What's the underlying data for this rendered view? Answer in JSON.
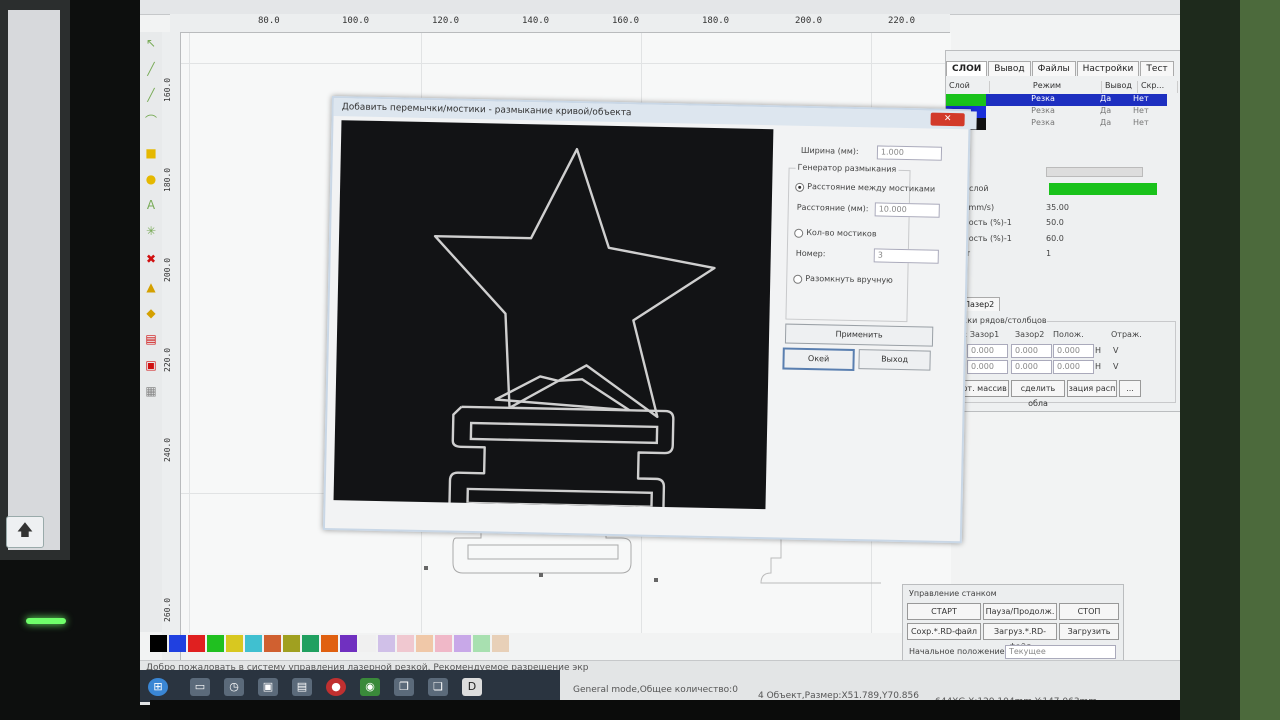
{
  "ruler_top": [
    "80.0",
    "100.0",
    "120.0",
    "140.0",
    "160.0",
    "180.0",
    "200.0",
    "220.0"
  ],
  "ruler_left": [
    "160.0",
    "180.0",
    "200.0",
    "220.0",
    "240.0",
    "260.0"
  ],
  "dialog": {
    "title": "Добавить перемычки/мостики - размыкание кривой/объекта",
    "close": "✕",
    "width_label": "Ширина (мм):",
    "width_value": "1.000",
    "group_title": "Генератор размыкания",
    "opt_distance": "Расстояние между мостиками",
    "distance_label": "Расстояние (мм):",
    "distance_value": "10.000",
    "opt_count": "Кол-во мостиков",
    "number_label": "Номер:",
    "number_value": "3",
    "opt_manual": "Разомкнуть вручную",
    "apply": "Применить",
    "ok": "Окей",
    "exit": "Выход"
  },
  "right_panel": {
    "tabs": [
      "СЛОИ",
      "Вывод",
      "Файлы",
      "Настройки",
      "Тест"
    ],
    "headers": [
      "Слой",
      "Режим",
      "Вывод",
      "Скр..."
    ],
    "rows": [
      {
        "color": "#19c21b",
        "mode": "Резка",
        "out": "Да",
        "hide": "Нет",
        "selected": true
      },
      {
        "color": "#1a2fd8",
        "mode": "Резка",
        "out": "Да",
        "hide": "Нет",
        "selected": false
      },
      {
        "color": "#111111",
        "mode": "Резка",
        "out": "Да",
        "hide": "Нет",
        "selected": false
      }
    ],
    "prop_layer": "ий слой",
    "prop_speed": "ть(mm/s)",
    "prop_speed_val": "35.00",
    "prop_p1": "щность (%)-1",
    "prop_p1_val": "50.0",
    "prop_p2": "щность (%)-1",
    "prop_p2_val": "60.0",
    "prop_prio": "тет",
    "prop_prio_val": "1",
    "laser2": "Лазер2",
    "array_title": "ржки рядов/столбцов",
    "array_gap1": "во: Зазор1",
    "array_gap2": "Зазор2",
    "array_pos": "Полож.",
    "array_mirror": "Отраж.",
    "array_val": "0.000",
    "array_h": "H",
    "array_v": "V",
    "btn_virt": "ирт. массив",
    "btn_del": "сделить обла",
    "btn_loc": "зация расп",
    "btn_more": "..."
  },
  "machine_panel": {
    "title": "Управление станком",
    "start": "СТАРТ",
    "pause": "Пауза/Продолж.",
    "stop": "СТОП",
    "save_rd": "Сохр.*.RD-файл",
    "load_rd": "Загруз.*.RD-файл",
    "load": "Загрузить",
    "home_label": "Начальное положение:",
    "home_value": "Текущее"
  },
  "status": {
    "welcome": "Добро пожаловать в систему управления лазерной резкой. Рекомендуемое разрешение экр",
    "mode": "General mode,Общее количество:0",
    "objects": "4 Объект,Размер:X51.789,Y70.856",
    "coords": "644XG,X:129.104mm,Y:147.063mm"
  },
  "palette": [
    "#000000",
    "#2040e0",
    "#e02020",
    "#20c020",
    "#d8c820",
    "#40c0d0",
    "#d06030",
    "#a0a020",
    "#20a060",
    "#e06010",
    "#7030c0",
    "#f0f0f0",
    "#d0c0e8",
    "#f0c8d0",
    "#f0c8a8",
    "#f0b8c8",
    "#c8a8e8",
    "#a8e0b0",
    "#e8d0b8"
  ],
  "upload_glyph": "🡅"
}
